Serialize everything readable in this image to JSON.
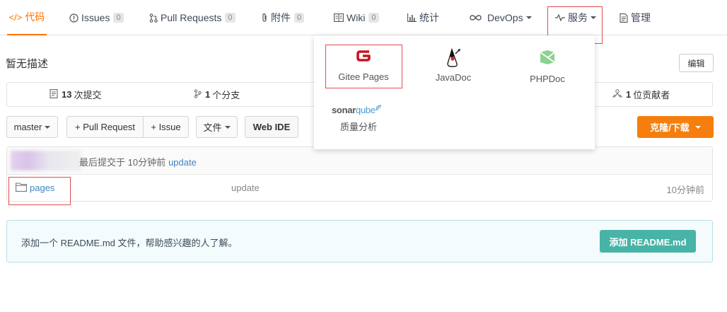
{
  "nav": {
    "tabs": [
      {
        "label": "代码",
        "icon": "code-icon",
        "count": "",
        "active": true
      },
      {
        "label": "Issues",
        "icon": "info-circle-icon",
        "count": "0"
      },
      {
        "label": "Pull Requests",
        "icon": "pull-request-icon",
        "count": "0"
      },
      {
        "label": "附件",
        "icon": "paperclip-icon",
        "count": "0"
      },
      {
        "label": "Wiki",
        "icon": "wiki-icon",
        "count": "0"
      },
      {
        "label": "统计",
        "icon": "bar-chart-icon",
        "count": ""
      },
      {
        "label": "DevOps",
        "icon": "infinity-icon",
        "count": ""
      },
      {
        "label": "服务",
        "icon": "pulse-icon",
        "count": ""
      },
      {
        "label": "管理",
        "icon": "settings-doc-icon",
        "count": ""
      }
    ]
  },
  "repo": {
    "description": "暂无描述",
    "edit_label": "编辑"
  },
  "stats": {
    "commits_count": "13",
    "commits_label": "次提交",
    "branches_count": "1",
    "branches_label": "个分支",
    "contributors_count": "1",
    "contributors_label": "位贡献者"
  },
  "toolbar": {
    "branch": "master",
    "pull_request": "+ Pull Request",
    "issue": "+ Issue",
    "file": "文件",
    "web_ide": "Web IDE",
    "clone": "克隆/下载"
  },
  "files": {
    "last_commit_prefix": "最后提交于 10分钟前",
    "last_commit_link": "update",
    "rows": [
      {
        "name": "pages",
        "message": "update",
        "time": "10分钟前"
      }
    ]
  },
  "readme": {
    "text": "添加一个 README.md 文件，帮助感兴趣的人了解。",
    "button": "添加 README.md"
  },
  "services_menu": {
    "items": [
      {
        "label": "Gitee Pages",
        "icon": "gitee-g-icon"
      },
      {
        "label": "JavaDoc",
        "icon": "java-duke-icon"
      },
      {
        "label": "PHPDoc",
        "icon": "phpdoc-icon"
      },
      {
        "label": "质量分析",
        "icon": "sonarqube-logo",
        "logo_text": "sonar",
        "logo_text2": "qube"
      }
    ]
  },
  "colors": {
    "accent": "#fe7300",
    "link": "#4183c4",
    "clone_button": "#f57e0d",
    "readme_button": "#48b3a7",
    "highlight_box": "#e34d4d"
  }
}
